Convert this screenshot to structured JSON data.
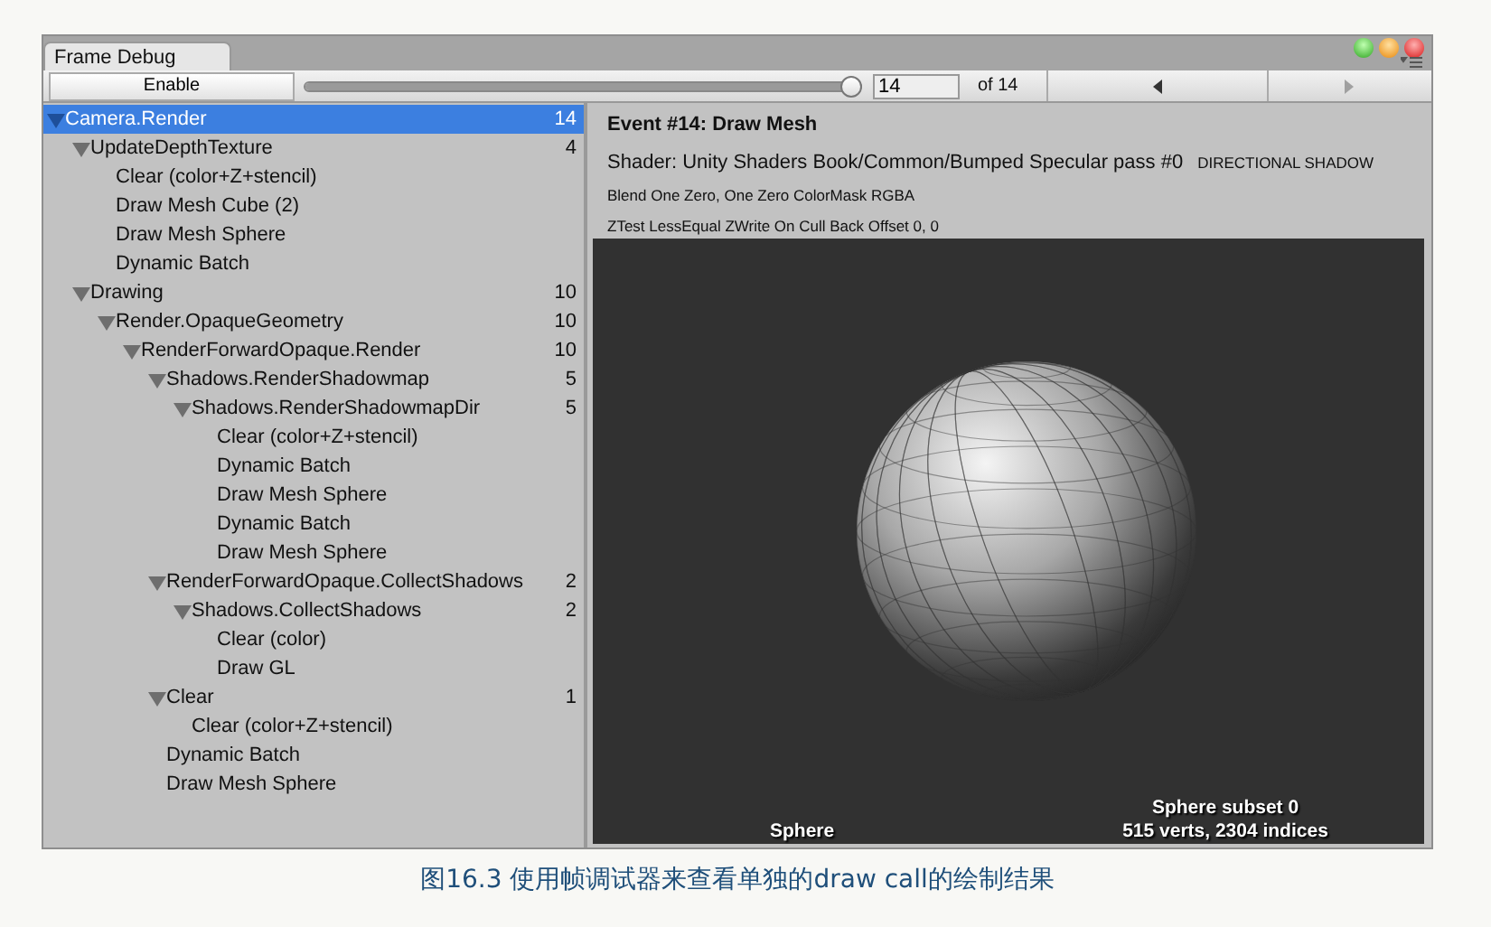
{
  "window": {
    "tab": "Frame Debug"
  },
  "toolbar": {
    "enable_button": "Enable",
    "slider": {
      "level": 1
    },
    "event_field": "14",
    "event_total": "of 14",
    "nav_buttons": [
      {
        "kind": "prev",
        "disabled": false
      },
      {
        "kind": "next",
        "disabled": true
      }
    ]
  },
  "tree": [
    {
      "label": "Camera.Render",
      "count": "14",
      "expanded": true,
      "selected": true,
      "children": [
        {
          "label": "UpdateDepthTexture",
          "count": "4",
          "expanded": true,
          "selected": false,
          "children": [
            {
              "label": "Clear (color+Z+stencil)",
              "selected": false
            },
            {
              "label": "Draw Mesh Cube (2)",
              "selected": false
            },
            {
              "label": "Draw Mesh Sphere",
              "selected": false
            },
            {
              "label": "Dynamic Batch",
              "selected": false
            }
          ]
        },
        {
          "label": "Drawing",
          "count": "10",
          "expanded": true,
          "selected": false,
          "children": [
            {
              "label": "Render.OpaqueGeometry",
              "count": "10",
              "expanded": true,
              "selected": false,
              "children": [
                {
                  "label": "RenderForwardOpaque.Render",
                  "count": "10",
                  "expanded": true,
                  "selected": false,
                  "children": [
                    {
                      "label": "Shadows.RenderShadowmap",
                      "count": "5",
                      "expanded": true,
                      "selected": false,
                      "children": [
                        {
                          "label": "Shadows.RenderShadowmapDir",
                          "count": "5",
                          "expanded": true,
                          "selected": false,
                          "children": [
                            {
                              "label": "Clear (color+Z+stencil)",
                              "selected": false
                            },
                            {
                              "label": "Dynamic Batch",
                              "selected": false
                            },
                            {
                              "label": "Draw Mesh Sphere",
                              "selected": false
                            },
                            {
                              "label": "Dynamic Batch",
                              "selected": false
                            },
                            {
                              "label": "Draw Mesh Sphere",
                              "selected": false
                            }
                          ]
                        }
                      ]
                    },
                    {
                      "label": "RenderForwardOpaque.CollectShadows",
                      "count": "2",
                      "expanded": true,
                      "selected": false,
                      "children": [
                        {
                          "label": "Shadows.CollectShadows",
                          "count": "2",
                          "expanded": true,
                          "selected": false,
                          "children": [
                            {
                              "label": "Clear (color)",
                              "selected": false
                            },
                            {
                              "label": "Draw GL",
                              "selected": false
                            }
                          ]
                        }
                      ]
                    },
                    {
                      "label": "Clear",
                      "count": "1",
                      "expanded": true,
                      "selected": false,
                      "children": [
                        {
                          "label": "Clear (color+Z+stencil)",
                          "selected": false
                        }
                      ]
                    },
                    {
                      "label": "Dynamic Batch",
                      "selected": false
                    },
                    {
                      "label": "Draw Mesh Sphere",
                      "selected": false
                    }
                  ]
                }
              ]
            }
          ]
        }
      ]
    }
  ],
  "details": {
    "title": "Event #14: Draw Mesh",
    "shader": "Shader: Unity Shaders Book/Common/Bumped Specular pass #0",
    "keywords": "DIRECTIONAL SHADOW",
    "state_lines": [
      "Blend One Zero, One Zero ColorMask RGBA",
      "ZTest LessEqual ZWrite On Cull Back Offset 0, 0"
    ]
  },
  "preview": {
    "mesh_name": "Sphere",
    "subset": "Sphere subset 0",
    "stats": "515 verts, 2304 indices"
  },
  "caption": "图16.3 使用帧调试器来查看单独的draw call的绘制结果"
}
